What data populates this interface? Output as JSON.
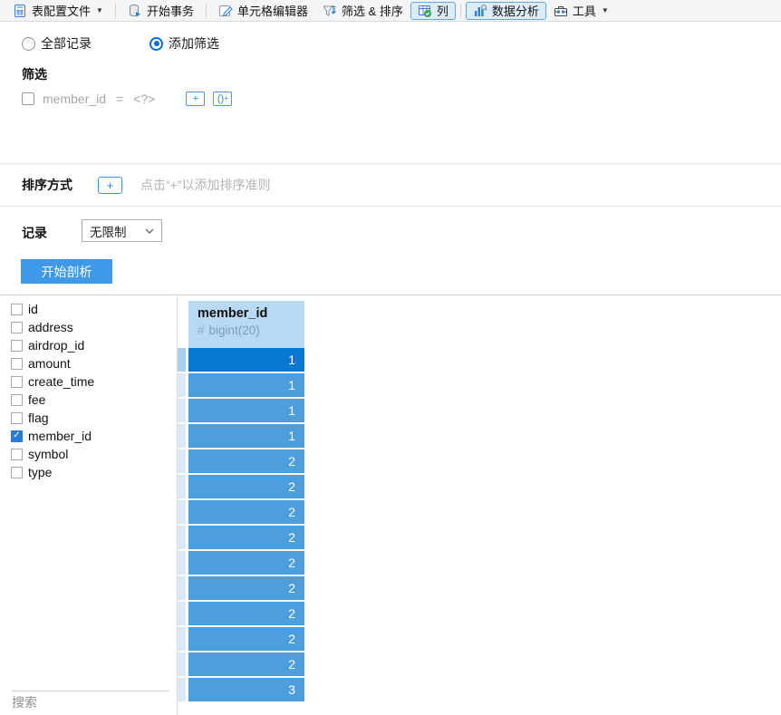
{
  "toolbar": {
    "items": [
      {
        "label": "表配置文件",
        "icon": "table-profile-icon",
        "caret": true,
        "active": false
      },
      {
        "label": "开始事务",
        "icon": "begin-transaction-icon",
        "caret": false,
        "active": false
      },
      {
        "label": "单元格编辑器",
        "icon": "cell-editor-icon",
        "caret": false,
        "active": false
      },
      {
        "label": "筛选 & 排序",
        "icon": "filter-sort-icon",
        "caret": false,
        "active": false
      },
      {
        "label": "列",
        "icon": "columns-check-icon",
        "caret": false,
        "active": true
      },
      {
        "label": "数据分析",
        "icon": "data-analysis-icon",
        "caret": false,
        "active": true
      },
      {
        "label": "工具",
        "icon": "toolbox-icon",
        "caret": true,
        "active": false
      }
    ]
  },
  "scope": {
    "all_records_label": "全部记录",
    "add_filter_label": "添加筛选",
    "selected": "添加筛选"
  },
  "filter": {
    "title": "筛选",
    "condition": {
      "checked": false,
      "field": "member_id",
      "operator": "=",
      "value": "<?>"
    },
    "add_condition_label": "+",
    "add_group_label": "()"
  },
  "sort": {
    "title": "排序方式",
    "add_label": "+",
    "hint": "点击“+”以添加排序准则"
  },
  "records": {
    "title": "记录",
    "limit_value": "无限制"
  },
  "profile_button_label": "开始剖析",
  "fields": {
    "items": [
      {
        "name": "id",
        "checked": false
      },
      {
        "name": "address",
        "checked": false
      },
      {
        "name": "airdrop_id",
        "checked": false
      },
      {
        "name": "amount",
        "checked": false
      },
      {
        "name": "create_time",
        "checked": false
      },
      {
        "name": "fee",
        "checked": false
      },
      {
        "name": "flag",
        "checked": false
      },
      {
        "name": "member_id",
        "checked": true
      },
      {
        "name": "symbol",
        "checked": false
      },
      {
        "name": "type",
        "checked": false
      }
    ],
    "search_label": "搜索"
  },
  "grid": {
    "column": {
      "name": "member_id",
      "type": "bigint(20)",
      "type_icon": "#"
    },
    "rows": [
      "1",
      "1",
      "1",
      "1",
      "2",
      "2",
      "2",
      "2",
      "2",
      "2",
      "2",
      "2",
      "2",
      "3"
    ],
    "selected_row_index": 0
  },
  "colors": {
    "accent_blue": "#0b6bd4",
    "row_blue": "#4d9edd",
    "selected_row_blue": "#0777d2",
    "header_blue": "#b9d9f2",
    "button_blue": "#3e9ae9",
    "toggled_button_bg": "#ddecf9"
  }
}
